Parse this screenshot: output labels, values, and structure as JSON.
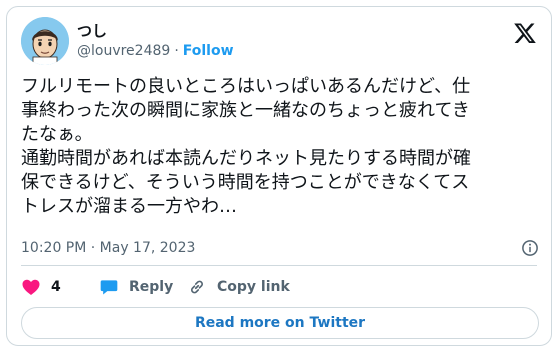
{
  "author": {
    "display_name": "つし",
    "handle": "@louvre2489",
    "separator": "·",
    "follow_label": "Follow",
    "avatar_icon": "cartoon-man-avatar"
  },
  "tweet": {
    "text": "フルリモートの良いところはいっぱいあるんだけど、仕\n事終わった次の瞬間に家族と一緒なのちょっと疲れてき\nたなぁ。\n通勤時間があれば本読んだりネット見たりする時間が確\n保できるけど、そういう時間を持つことができなくてス\nトレスが溜まる一方やわ…"
  },
  "meta": {
    "timestamp": "10:20 PM · May 17, 2023",
    "info_icon": "info-icon"
  },
  "actions": {
    "like_count": "4",
    "reply_label": "Reply",
    "copy_label": "Copy link"
  },
  "footer": {
    "read_more_label": "Read more on Twitter"
  },
  "colors": {
    "accent": "#1d9bf0",
    "heart": "#f91880",
    "border": "#cfd9de",
    "muted": "#536471",
    "text": "#0f1419"
  }
}
